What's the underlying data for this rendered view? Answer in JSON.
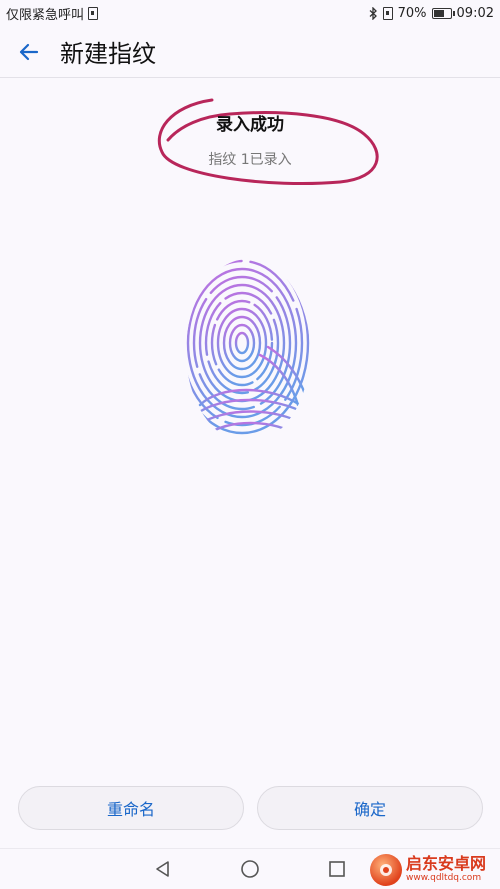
{
  "status_bar": {
    "carrier_text": "仅限紧急呼叫",
    "battery_percent_text": "70%",
    "battery_level": 0.7,
    "time": "09:02"
  },
  "header": {
    "title": "新建指纹"
  },
  "result": {
    "title": "录入成功",
    "subtitle": "指纹 1已录入"
  },
  "buttons": {
    "rename_label": "重命名",
    "confirm_label": "确定"
  },
  "watermark": {
    "name": "启东安卓网",
    "url": "www.qdltdq.com"
  },
  "icons": {
    "back": "arrow-left-icon",
    "bluetooth": "bluetooth-icon",
    "sim": "sim-card-icon",
    "battery": "battery-icon",
    "fingerprint": "fingerprint-icon",
    "nav_back": "triangle-back-icon",
    "nav_home": "circle-home-icon",
    "nav_recent": "square-recent-icon"
  },
  "colors": {
    "accent": "#1a67c9",
    "annotation": "#b8265a",
    "fingerprint_top": "#c070e0",
    "fingerprint_bottom": "#6a9ce8"
  }
}
